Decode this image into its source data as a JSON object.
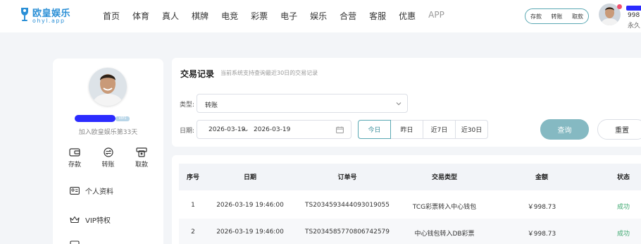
{
  "brand": {
    "name": "欧皇娱乐",
    "domain": "ohyl.app",
    "color": "#2a8fd6"
  },
  "nav": {
    "items": [
      "首页",
      "体育",
      "真人",
      "棋牌",
      "电竞",
      "彩票",
      "电子",
      "娱乐",
      "合营",
      "客服",
      "优惠",
      "APP"
    ],
    "quick": {
      "deposit": "存款",
      "transfer": "转账",
      "withdraw": "取款"
    }
  },
  "user": {
    "balance": "998",
    "tag": "永久"
  },
  "sidebar": {
    "vip_badge": "VIP1",
    "join_text": "加入欧皇娱乐第33天",
    "actions": [
      {
        "label": "存款",
        "icon": "wallet-icon"
      },
      {
        "label": "转账",
        "icon": "exchange-icon"
      },
      {
        "label": "取款",
        "icon": "withdraw-icon"
      }
    ],
    "menu": [
      {
        "label": "个人资料",
        "icon": "profile-card-icon"
      },
      {
        "label": "VIP特权",
        "icon": "crown-icon"
      }
    ]
  },
  "filter": {
    "title": "交易记录",
    "hint": "当前系统支持查询最近30日的交易记录",
    "type_label": "类型:",
    "type_value": "转账",
    "date_label": "日期:",
    "date_start": "2026-03-19",
    "date_sep": "～",
    "date_end": "2026-03-19",
    "quick_tabs": [
      "今日",
      "昨日",
      "近7日",
      "近30日"
    ],
    "active_tab": "今日",
    "search_label": "查询",
    "reset_label": "重置",
    "accent": "#5aa8b3"
  },
  "table": {
    "headers": [
      "序号",
      "日期",
      "订单号",
      "交易类型",
      "金额",
      "状态"
    ],
    "rows": [
      {
        "no": "1",
        "date": "2026-03-19 19:46:00",
        "order": "TS2034593444093019055",
        "type": "TCG彩票转入中心钱包",
        "amount": "￥998.73",
        "status": "成功"
      },
      {
        "no": "2",
        "date": "2026-03-19 19:46:00",
        "order": "TS2034585770806742579",
        "type": "中心钱包转入DB彩票",
        "amount": "￥998.73",
        "status": "成功"
      }
    ],
    "status_color": "#3aa76d"
  }
}
